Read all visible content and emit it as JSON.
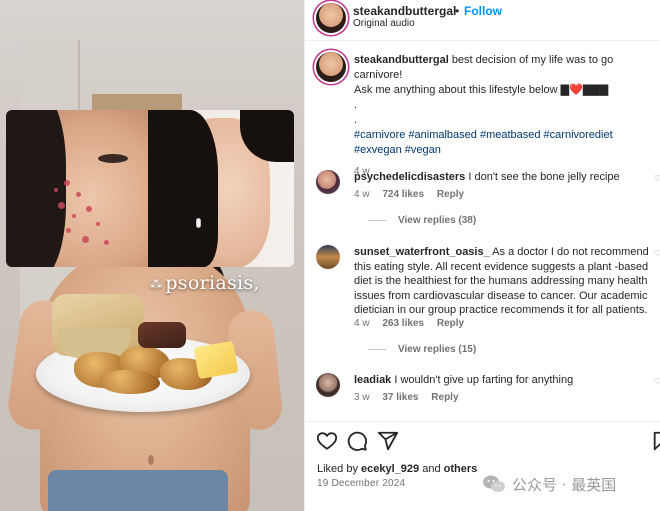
{
  "media": {
    "overlay_text": "psoriasis,",
    "sparkle": "⁂"
  },
  "header": {
    "username": "steakandbuttergal",
    "separator": "•",
    "follow_label": "Follow",
    "audio_label": "Original audio"
  },
  "post": {
    "username": "steakandbuttergal",
    "caption_line1": "best decision of my life was to go carnivore!",
    "caption_line2": "Ask me anything about this lifestyle below",
    "emoji": "▇❤️▇▇▇",
    "dot1": ".",
    "dot2": ".",
    "hashtags": "#carnivore #animalbased #meatbased #carnivorediet #exvegan #vegan",
    "age": "4 w"
  },
  "comments": [
    {
      "username": "psychedelicdisasters",
      "text": "I don't see the bone jelly recipe",
      "age": "4 w",
      "likes": "724 likes",
      "reply_label": "Reply",
      "view_replies": "View replies (38)"
    },
    {
      "username": "sunset_waterfront_oasis_",
      "text": "As a doctor I do not recommend this eating style. All recent evidence suggests a plant -based diet is the healthiest for the humans addressing many health issues from cardiovascular disease to cancer. Our academic dietician in our group practice recommends it for all patients.",
      "age": "4 w",
      "likes": "263 likes",
      "reply_label": "Reply",
      "view_replies": "View replies (15)"
    },
    {
      "username": "leadiak",
      "text": "I wouldn't give up farting for anything",
      "age": "3 w",
      "likes": "37 likes",
      "reply_label": "Reply"
    }
  ],
  "footer": {
    "liked_prefix": "Liked by",
    "liked_user": "ecekyl_929",
    "liked_and": "and",
    "liked_others": "others",
    "date": "19 December 2024"
  },
  "watermark": {
    "text": "公众号 · 最英国"
  },
  "icons": {
    "like": "heart-icon",
    "comment": "comment-icon",
    "share": "share-icon",
    "save": "bookmark-icon"
  },
  "colors": {
    "follow": "#0095f6",
    "hashtag": "#00376b",
    "muted": "#737373",
    "story_ring": "#c1358a"
  }
}
